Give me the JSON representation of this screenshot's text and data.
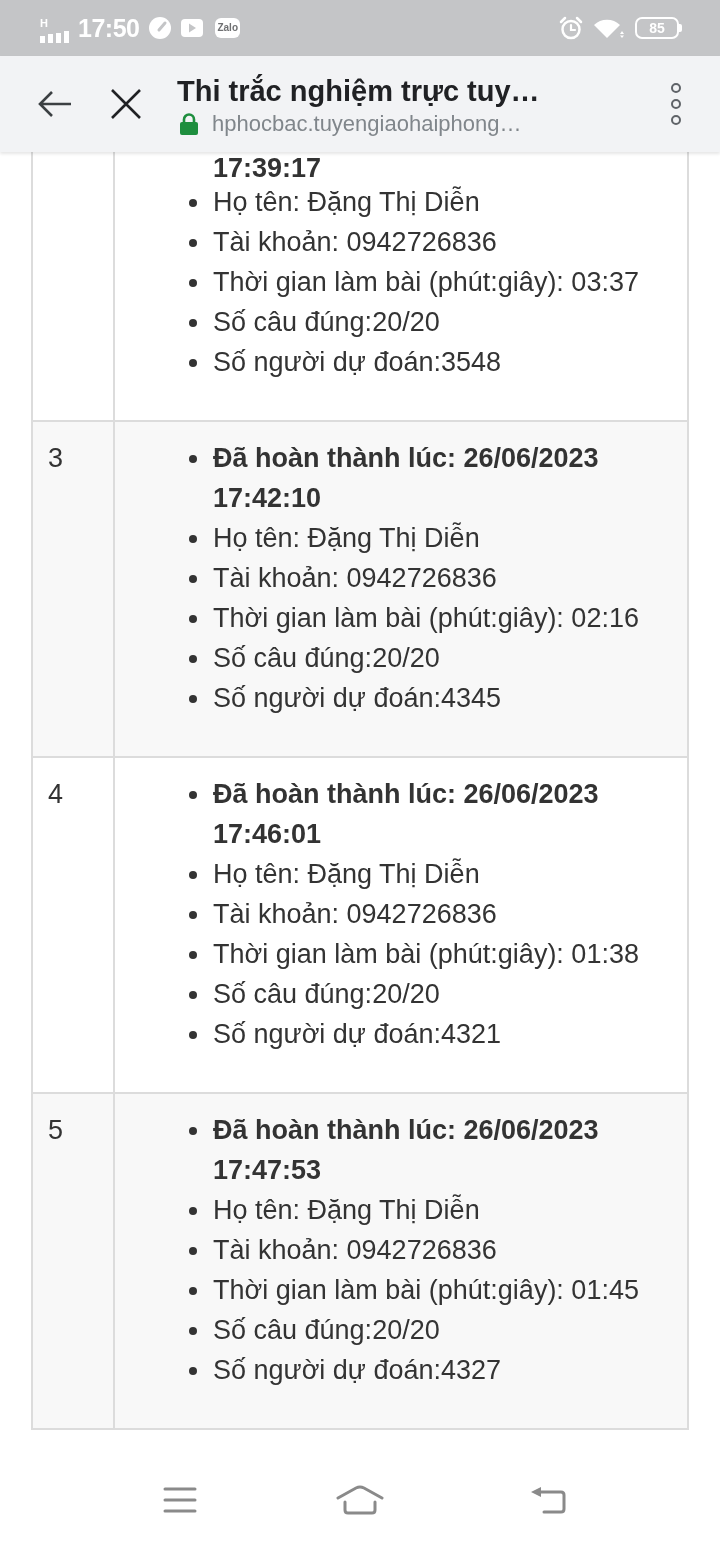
{
  "status_bar": {
    "network": "H",
    "time": "17:50",
    "app_logo": "Zalo",
    "battery": "85"
  },
  "toolbar": {
    "title": "Thi trắc nghiệm trực tuy…",
    "url": "hphocbac.tuyengiaohaiphong…"
  },
  "results": [
    {
      "kind": "continued",
      "completed": "17:39:17",
      "details": [
        "Họ tên: Đặng Thị Diễn",
        "Tài khoản: 0942726836",
        "Thời gian làm bài (phút:giây): 03:37",
        "Số câu đúng:20/20",
        "Số người dự đoán:3548"
      ]
    },
    {
      "kind": "entry",
      "number": "3",
      "completed": "Đã hoàn thành lúc: 26/06/2023 17:42:10",
      "details": [
        "Họ tên: Đặng Thị Diễn",
        "Tài khoản: 0942726836",
        "Thời gian làm bài (phút:giây): 02:16",
        "Số câu đúng:20/20",
        "Số người dự đoán:4345"
      ]
    },
    {
      "kind": "entry",
      "number": "4",
      "completed": "Đã hoàn thành lúc: 26/06/2023 17:46:01",
      "details": [
        "Họ tên: Đặng Thị Diễn",
        "Tài khoản: 0942726836",
        "Thời gian làm bài (phút:giây): 01:38",
        "Số câu đúng:20/20",
        "Số người dự đoán:4321"
      ]
    },
    {
      "kind": "entry",
      "number": "5",
      "completed": "Đã hoàn thành lúc: 26/06/2023 17:47:53",
      "details": [
        "Họ tên: Đặng Thị Diễn",
        "Tài khoản: 0942726836",
        "Thời gian làm bài (phút:giây): 01:45",
        "Số câu đúng:20/20",
        "Số người dự đoán:4327"
      ]
    }
  ]
}
